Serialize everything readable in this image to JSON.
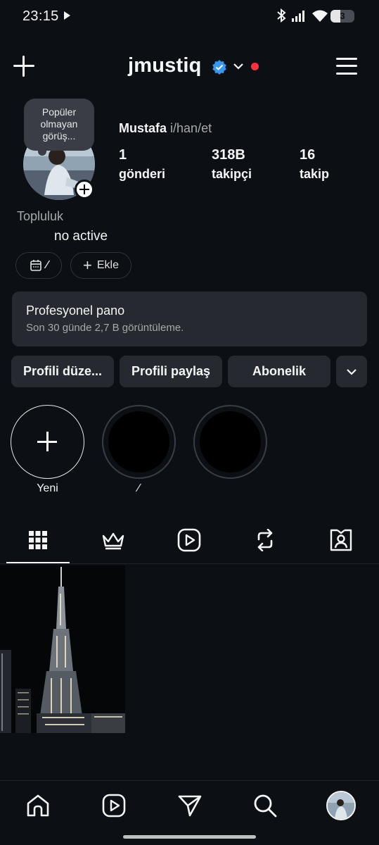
{
  "status_bar": {
    "time": "23:15",
    "battery": "3"
  },
  "header": {
    "username": "jmustiq"
  },
  "profile": {
    "note": "Popüler olmayan görüş...",
    "full_name": "Mustafa",
    "pronouns": "i/han/et",
    "stats": [
      {
        "value": "1",
        "label": "gönderi"
      },
      {
        "value": "318B",
        "label": "takipçi"
      },
      {
        "value": "16",
        "label": "takip"
      }
    ],
    "category": "Topluluk",
    "bio": "no active"
  },
  "chips": {
    "calendar_suffix": "⁄",
    "add_label": "Ekle"
  },
  "dashboard": {
    "title": "Profesyonel pano",
    "subtitle": "Son 30 günde 2,7 B görüntüleme."
  },
  "buttons": {
    "edit": "Profili düze...",
    "share": "Profili paylaş",
    "subscription": "Abonelik"
  },
  "highlights": [
    {
      "label": "Yeni"
    },
    {
      "label": "⁄"
    },
    {
      "label": ""
    }
  ],
  "icons": {
    "tabs": [
      "grid-icon",
      "crown-icon",
      "reels-icon",
      "repost-icon",
      "tagged-icon"
    ],
    "nav": [
      "home-icon",
      "reels-icon",
      "send-icon",
      "search-icon",
      "profile-avatar"
    ]
  },
  "colors": {
    "background": "#0c0f14",
    "verified": "#3897f0",
    "notification": "#ff3040",
    "surface": "#26292f"
  }
}
